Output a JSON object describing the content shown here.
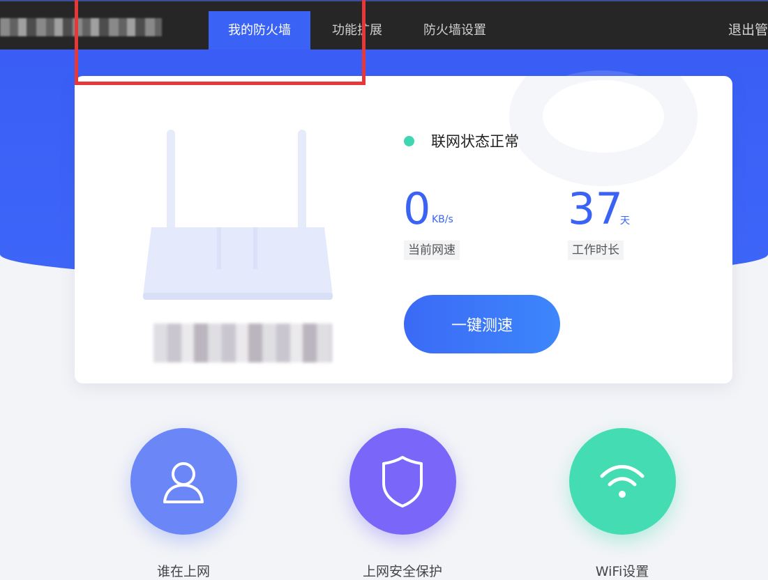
{
  "nav": {
    "tabs": [
      {
        "label": "我的防火墙"
      },
      {
        "label": "功能扩展"
      },
      {
        "label": "防火墙设置"
      }
    ],
    "logout_label": "退出管"
  },
  "status": {
    "connection_text": "联网状态正常",
    "speed": {
      "value": "0",
      "unit": "KB/s",
      "label": "当前网速"
    },
    "uptime": {
      "value": "37",
      "unit": "天",
      "label": "工作时长"
    },
    "speed_test_button": "一键测速"
  },
  "features": [
    {
      "label": "谁在上网",
      "icon": "user-icon",
      "color": "#6b87f7"
    },
    {
      "label": "上网安全保护",
      "icon": "shield-icon",
      "color": "#7a66f8"
    },
    {
      "label": "WiFi设置",
      "icon": "wifi-icon",
      "color": "#43dcb3"
    }
  ],
  "colors": {
    "accent": "#3a63f6",
    "status_ok": "#3fd7b2",
    "highlight": "#e63838"
  }
}
